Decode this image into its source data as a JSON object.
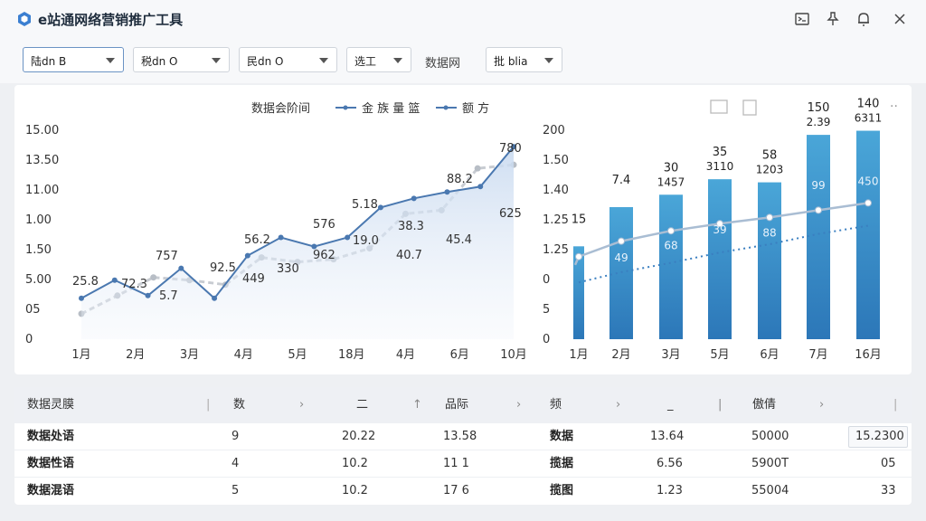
{
  "app": {
    "title": "e站通网络营销推广工具"
  },
  "window_controls": [
    "screenshot-icon",
    "pin-icon",
    "bell-icon",
    "close-icon"
  ],
  "filters": {
    "dropdowns": [
      {
        "label": "陆dn B",
        "active": true
      },
      {
        "label": "税dn O"
      },
      {
        "label": "民dn O"
      },
      {
        "label": "选工"
      },
      {
        "label": "批 blia"
      }
    ],
    "label": "数据网"
  },
  "left_chart": {
    "legend_title": "数据会阶间",
    "legend": [
      "金 族 量 篮",
      "额 方"
    ]
  },
  "chart_data": [
    {
      "type": "line",
      "y_ticks": [
        "15.00",
        "13.50",
        "11.00",
        "1.00",
        "1.50",
        "5.00",
        "05",
        "0"
      ],
      "categories": [
        "1月",
        "2月",
        "3月",
        "4月",
        "5月",
        "18月",
        "4月",
        "6月",
        "10月"
      ],
      "series": [
        {
          "name": "金 族 量 篮",
          "color": "#4a78b0",
          "values": [
            0.95,
            1.15,
            0.98,
            1.28,
            0.95,
            1.42,
            1.62,
            1.52,
            1.62,
            1.95,
            2.05,
            2.12,
            2.18,
            2.62
          ]
        },
        {
          "name": "额 方",
          "color": "#c8ccd2",
          "values": [
            0.78,
            0.98,
            1.18,
            1.15,
            1.1,
            1.4,
            1.35,
            1.38,
            1.5,
            1.88,
            1.92,
            2.38,
            2.42
          ]
        }
      ],
      "data_labels": [
        "25.8",
        "72.3",
        "757",
        "5.7",
        "92.5",
        "449",
        "56.2",
        "330",
        "576",
        "962",
        "5.18",
        "19.0",
        "38.3",
        "40.7",
        "88.2",
        "45.4",
        "780",
        "625"
      ]
    },
    {
      "type": "bar",
      "y_ticks": [
        "200",
        "1.50",
        "1.40",
        "1.25",
        "1.25",
        "0",
        "5",
        "0"
      ],
      "categories": [
        "1月",
        "2月",
        "3月",
        "5月",
        "6月",
        "7月",
        "16月"
      ],
      "values": [
        0.9,
        1.28,
        1.4,
        1.55,
        1.52,
        1.98,
        2.02
      ],
      "labels_top": [
        "15",
        "7.4",
        "30",
        "35",
        "58",
        "150",
        "140"
      ],
      "labels_second": [
        "",
        "",
        "1457",
        "3110",
        "1203",
        "2.39",
        "6311"
      ],
      "labels_inside": [
        "",
        "49",
        "68",
        "39",
        "88",
        "99",
        "450"
      ],
      "trend_solid": [
        0.8,
        0.95,
        1.05,
        1.12,
        1.18,
        1.25,
        1.32
      ],
      "trend_dotted": [
        0.55,
        0.65,
        0.74,
        0.84,
        0.92,
        1.02,
        1.1
      ]
    }
  ],
  "table": {
    "headers": [
      "数据灵膜",
      "数",
      "⼆",
      "品际",
      "频",
      "_",
      "傲倩"
    ],
    "rows": [
      [
        "数据处语",
        "9",
        "20.22",
        "13.58",
        "数据",
        "13.64",
        "50000",
        "15.2300"
      ],
      [
        "数据性语",
        "4",
        "10.2",
        "11  1",
        "揽据",
        "6.56",
        "5900T",
        "05"
      ],
      [
        "数据混语",
        "5",
        "10.2",
        "17  6",
        "揽图",
        "1.23",
        "55004",
        "33"
      ]
    ]
  }
}
